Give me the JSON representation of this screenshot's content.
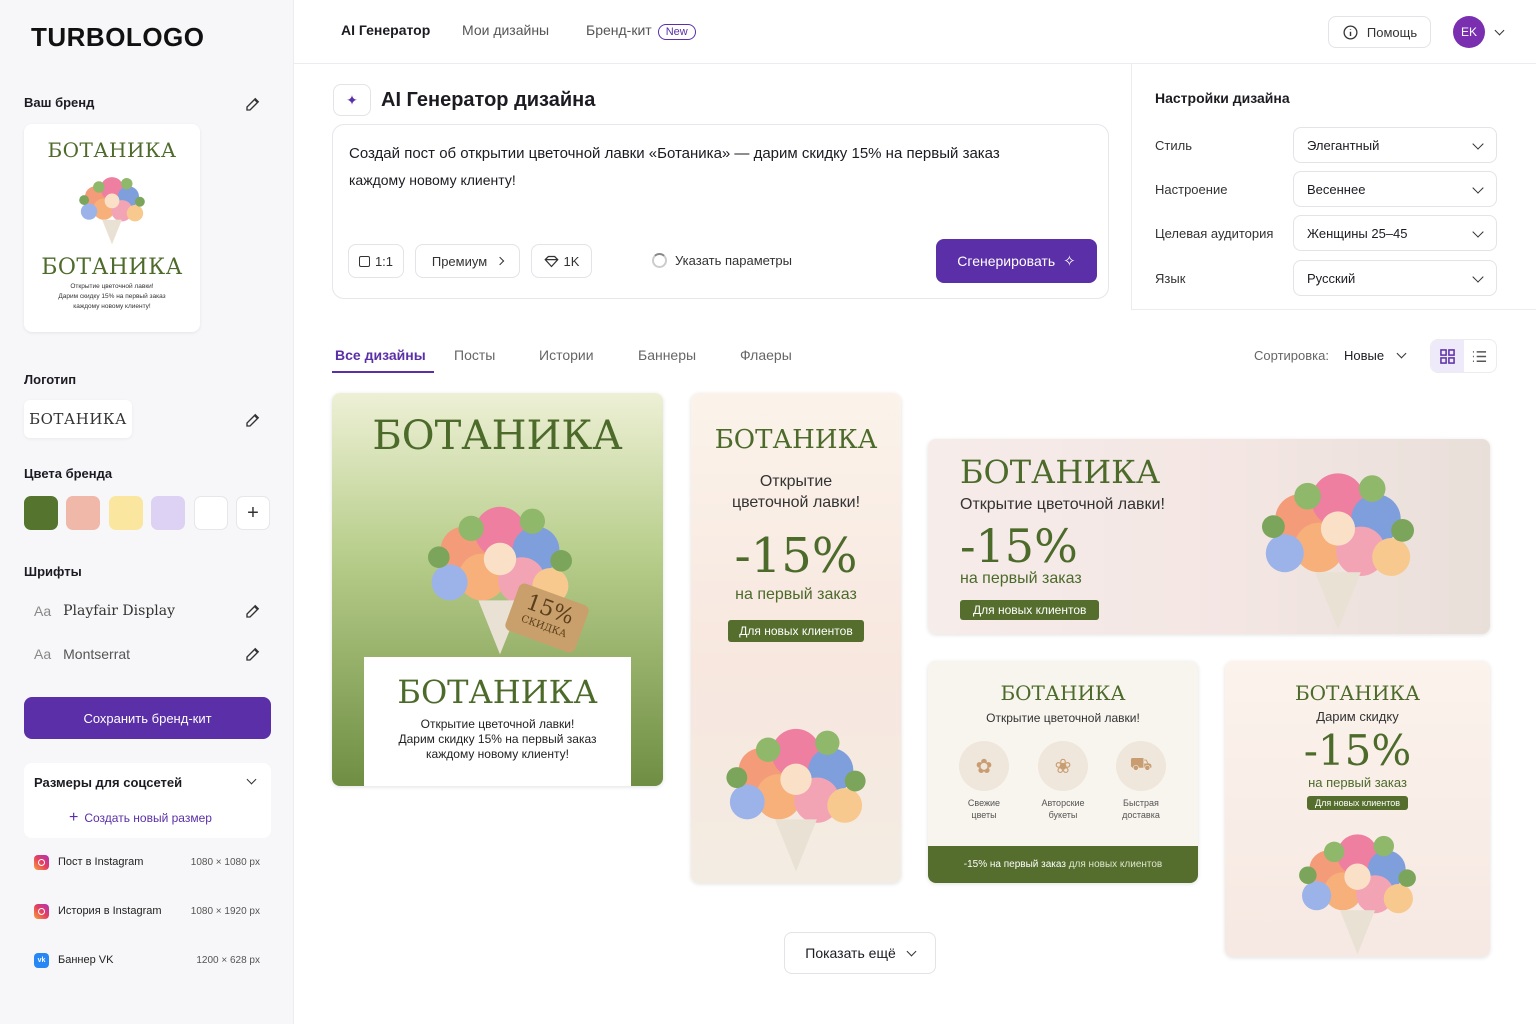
{
  "app": {
    "logo": "TURBOLOGO"
  },
  "sidebar": {
    "brand_heading": "Ваш бренд",
    "brand_card": {
      "title_top": "БОТАНИКА",
      "title_bottom": "БОТАНИКА",
      "line1": "Открытие цветочной лавки!",
      "line2": "Дарим скидку 15% на первый заказ",
      "line3": "каждому новому клиенту!"
    },
    "logo_heading": "Логотип",
    "logo_text": "БОТАНИКА",
    "colors_heading": "Цвета бренда",
    "colors": [
      "#55752f",
      "#efb8a8",
      "#fbe6a0",
      "#ddd1f4",
      "#ffffff"
    ],
    "add_color_label": "+",
    "fonts_heading": "Шрифты",
    "fonts": [
      {
        "prefix": "Aa",
        "name": "Playfair Display"
      },
      {
        "prefix": "Aa",
        "name": "Montserrat"
      }
    ],
    "save_label": "Сохранить бренд-кит",
    "sizes_heading": "Размеры для соцсетей",
    "create_size_label": "Создать новый размер",
    "sizes": [
      {
        "icon": "instagram-icon",
        "name": "Пост в Instagram",
        "dim": "1080 × 1080 px"
      },
      {
        "icon": "instagram-icon",
        "name": "История в Instagram",
        "dim": "1080 × 1920 px"
      },
      {
        "icon": "vk-icon",
        "name": "Баннер VK",
        "dim": "1200 × 628 px"
      }
    ]
  },
  "topbar": {
    "tabs": [
      "AI Генератор",
      "Мои дизайны",
      "Бренд-кит"
    ],
    "new_badge": "New",
    "help_label": "Помощь",
    "avatar_initials": "EK"
  },
  "generator": {
    "title": "AI Генератор дизайна",
    "prompt_line1": "Создай пост об открытии цветочной лавки «Ботаника» — дарим скидку 15% на первый заказ",
    "prompt_line2": "каждому новому клиенту!",
    "ratio": "1:1",
    "quality": "Премиум",
    "cost": "1K",
    "params_label": "Указать параметры",
    "generate_label": "Сгенерировать"
  },
  "settings": {
    "heading": "Настройки дизайна",
    "rows": [
      {
        "label": "Стиль",
        "value": "Элегантный"
      },
      {
        "label": "Настроение",
        "value": "Весеннее"
      },
      {
        "label": "Целевая аудитория",
        "value": "Женщины 25–45"
      },
      {
        "label": "Язык",
        "value": "Русский"
      }
    ]
  },
  "filters": {
    "tabs": [
      "Все дизайны",
      "Посты",
      "Истории",
      "Баннеры",
      "Флаеры"
    ],
    "active": "Все дизайны",
    "sort_label": "Сортировка:",
    "sort_value": "Новые"
  },
  "designs": {
    "post": {
      "title": "БОТАНИКА",
      "tag_num": "15%",
      "tag_text": "СКИДКА",
      "box_title": "БОТАНИКА",
      "l1": "Открытие цветочной лавки!",
      "l2": "Дарим скидку 15% на первый заказ",
      "l3": "каждому новому клиенту!"
    },
    "story": {
      "title": "БОТАНИКА",
      "l1": "Открытие",
      "l2": "цветочной лавки!",
      "discount": "-15%",
      "sub": "на первый заказ",
      "pill": "Для новых клиентов"
    },
    "banner": {
      "title": "БОТАНИКА",
      "l1": "Открытие цветочной лавки!",
      "discount": "-15%",
      "sub": "на первый заказ",
      "pill": "Для новых клиентов"
    },
    "flyer": {
      "title": "БОТАНИКА",
      "l1": "Открытие цветочной лавки!",
      "features": [
        {
          "t1": "Свежие",
          "t2": "цветы"
        },
        {
          "t1": "Авторские",
          "t2": "букеты"
        },
        {
          "t1": "Быстрая",
          "t2": "доставка"
        }
      ],
      "footer_a": "-15% на первый заказ",
      "footer_b": "для новых клиентов"
    },
    "post2": {
      "title": "БОТАНИКА",
      "l1": "Дарим скидку",
      "discount": "-15%",
      "sub": "на первый заказ",
      "pill": "Для новых клиентов"
    }
  },
  "show_more_label": "Показать ещё"
}
